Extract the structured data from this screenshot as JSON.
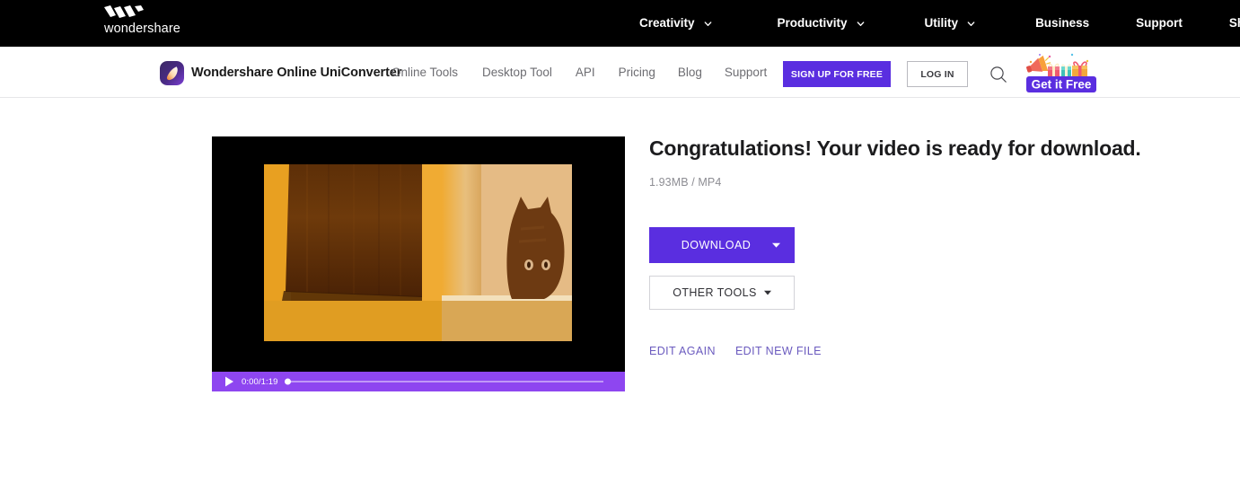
{
  "topbar": {
    "brand": "wondershare",
    "brand_mark_icon": "wondershare-w-logo",
    "nav": [
      {
        "label": "Creativity",
        "has_chevron": true,
        "icon": "chevron-down-icon"
      },
      {
        "label": "Productivity",
        "has_chevron": true,
        "icon": "chevron-down-icon"
      },
      {
        "label": "Utility",
        "has_chevron": true,
        "icon": "chevron-down-icon"
      },
      {
        "label": "Business",
        "has_chevron": false,
        "icon": ""
      },
      {
        "label": "Support",
        "has_chevron": false,
        "icon": ""
      },
      {
        "label": "Shop",
        "has_chevron": false,
        "icon": ""
      }
    ]
  },
  "subbar": {
    "product_logo_icon": "uniconverter-flame-logo",
    "product_title": "Wondershare Online UniConverter",
    "links": [
      {
        "label": "Online Tools"
      },
      {
        "label": "Desktop Tool"
      },
      {
        "label": "API"
      },
      {
        "label": "Pricing"
      },
      {
        "label": "Blog"
      },
      {
        "label": "Support"
      }
    ],
    "signup_label": "SIGN UP FOR FREE",
    "login_label": "LOG IN",
    "search_icon": "search-icon",
    "promo": {
      "label": "Get it Free",
      "icon": "megaphone-gift-icon"
    }
  },
  "player": {
    "play_icon": "play-icon",
    "time": "0:00/1:19",
    "progress_percent": 0
  },
  "main": {
    "headline": "Congratulations! Your video is ready for download.",
    "file_info": "1.93MB / MP4",
    "download_label": "DOWNLOAD",
    "download_caret_icon": "caret-down-icon",
    "other_tools_label": "OTHER TOOLS",
    "other_tools_caret_icon": "caret-down-icon",
    "edit_again_label": "EDIT AGAIN",
    "edit_new_file_label": "EDIT NEW FILE"
  },
  "colors": {
    "accent_purple": "#5a2ee0",
    "player_purple": "#8e46f0",
    "link_purple": "#6b5bbf",
    "topbar_black": "#000000"
  }
}
